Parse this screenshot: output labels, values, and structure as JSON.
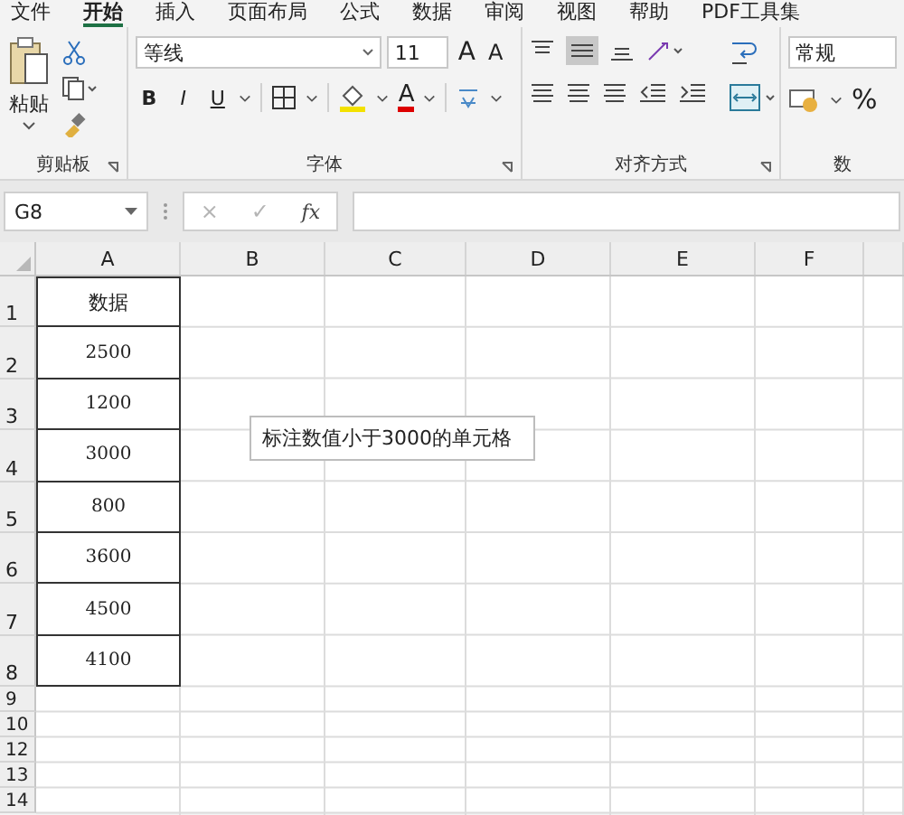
{
  "tabs": [
    {
      "label": "文件",
      "selected": false
    },
    {
      "label": "开始",
      "selected": true
    },
    {
      "label": "插入",
      "selected": false
    },
    {
      "label": "页面布局",
      "selected": false
    },
    {
      "label": "公式",
      "selected": false
    },
    {
      "label": "数据",
      "selected": false
    },
    {
      "label": "审阅",
      "selected": false
    },
    {
      "label": "视图",
      "selected": false
    },
    {
      "label": "帮助",
      "selected": false
    },
    {
      "label": "PDF工具集",
      "selected": false
    }
  ],
  "ribbon": {
    "clipboard": {
      "paste": "粘贴",
      "label": "剪贴板"
    },
    "font": {
      "name": "等线",
      "size": "11",
      "grow": "A",
      "shrink": "A",
      "bold": "B",
      "italic": "I",
      "underline": "U",
      "color_letter": "A",
      "label": "字体"
    },
    "alignment": {
      "label": "对齐方式"
    },
    "number": {
      "format": "常规",
      "percent": "%",
      "label": "数"
    }
  },
  "formula_bar": {
    "name_box": "G8",
    "cancel": "×",
    "enter": "✓",
    "function": "fx"
  },
  "sheet": {
    "columns": [
      "A",
      "B",
      "C",
      "D",
      "E",
      "F"
    ],
    "rows": [
      {
        "number": "1",
        "value": "数据"
      },
      {
        "number": "2",
        "value": "2500"
      },
      {
        "number": "3",
        "value": "1200"
      },
      {
        "number": "4",
        "value": "3000"
      },
      {
        "number": "5",
        "value": "800"
      },
      {
        "number": "6",
        "value": "3600"
      },
      {
        "number": "7",
        "value": "4500"
      },
      {
        "number": "8",
        "value": "4100"
      },
      {
        "number": "9"
      },
      {
        "number": "10"
      },
      {
        "number": "12"
      },
      {
        "number": "13"
      },
      {
        "number": "14"
      }
    ],
    "comment": "标注数值小于3000的单元格"
  }
}
